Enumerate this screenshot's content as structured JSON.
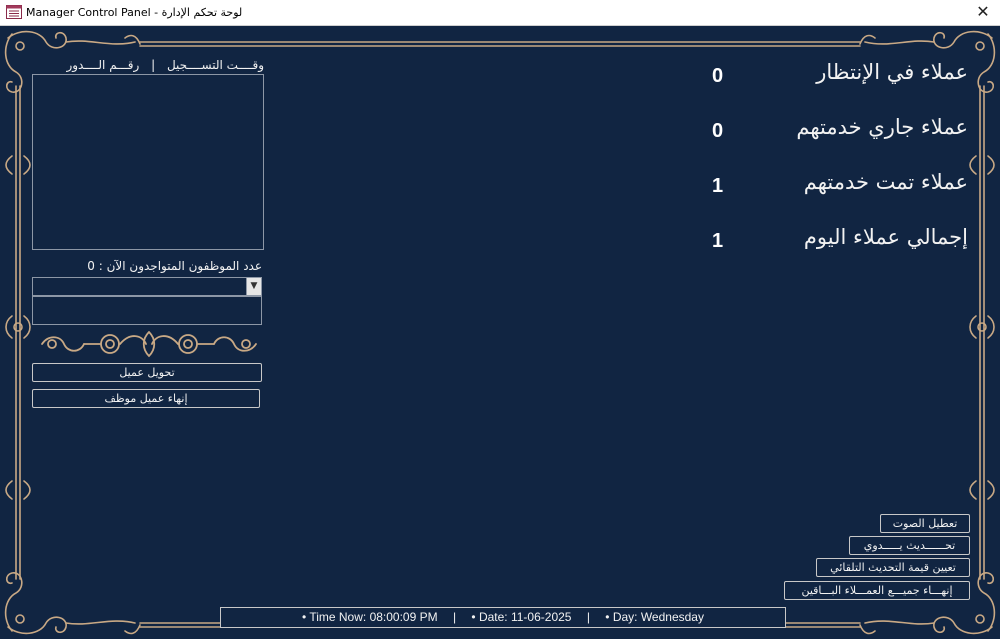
{
  "window": {
    "title": "Manager Control Panel - لوحة تحكم الإدارة",
    "close_glyph": "✕"
  },
  "stats": [
    {
      "label": "عملاء في الإنتظار",
      "value": "0"
    },
    {
      "label": "عملاء جاري خدمتهم",
      "value": "0"
    },
    {
      "label": "عملاء تمت خدمتهم",
      "value": "1"
    },
    {
      "label": "إجمالي عملاء اليوم",
      "value": "1"
    }
  ],
  "list": {
    "col_registration_time": "وقــــت التســــجيل",
    "separator": "|",
    "col_queue_number": "رقـــم الــــدور"
  },
  "staff": {
    "count_text": "عدد الموظفون المتواجدون الآن : 0",
    "select_value": ""
  },
  "actions": {
    "transfer_client": "تحويل عميل",
    "end_employee_client": "إنهاء عميل موظف",
    "disable_sound": "تعطيل الصوت",
    "manual_refresh": "تحــــــديث يـــــدوي",
    "set_auto_refresh": "تعيين قيمة التحديث التلقائي",
    "end_all_remaining": "إنهـــاء جميـــع العمـــلاء البـــاقين"
  },
  "status": {
    "time": "• Time Now: 08:00:09 PM",
    "sep1": "|",
    "date": "• Date: 11-06-2025",
    "sep2": "|",
    "day": "• Day: Wednesday"
  },
  "icons": {
    "app": "form-window-icon",
    "close": "close-icon",
    "ornament": "decorative-scroll-ornament"
  },
  "colors": {
    "background": "#112542",
    "frame": "#c9a985",
    "text": "#f2f2f2"
  }
}
